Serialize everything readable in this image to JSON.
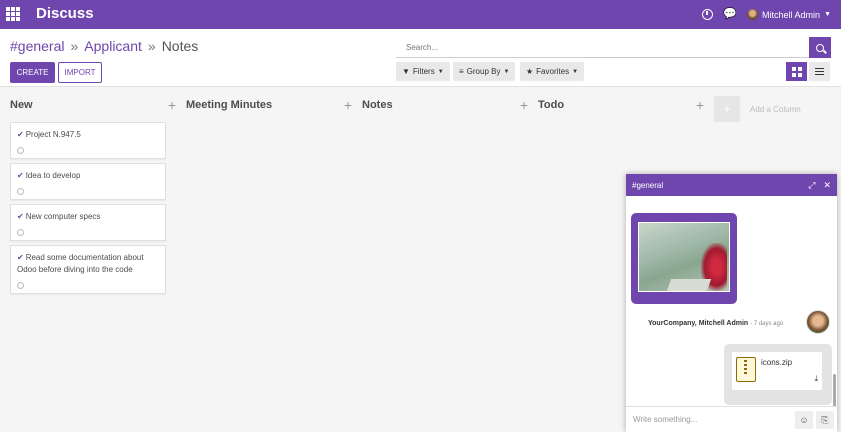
{
  "navbar": {
    "app_title": "Discuss",
    "user_name": "Mitchell Admin",
    "accent": "#6e46ad"
  },
  "breadcrumb": {
    "items": [
      "#general",
      "Applicant"
    ],
    "current": "Notes",
    "separator": "»"
  },
  "buttons": {
    "create": "CREATE",
    "import": "IMPORT"
  },
  "search": {
    "placeholder": "Search..."
  },
  "filters": {
    "filters_label": "Filters",
    "group_by_label": "Group By",
    "favorites_label": "Favorites"
  },
  "kanban": {
    "columns": [
      {
        "title": "New",
        "cards": [
          "Project N.947.5",
          "Idea to develop",
          "New computer specs",
          "Read some documentation about Odoo before diving into the code"
        ]
      },
      {
        "title": "Meeting Minutes",
        "cards": []
      },
      {
        "title": "Notes",
        "cards": []
      },
      {
        "title": "Todo",
        "cards": []
      }
    ],
    "add_column_label": "Add a Column"
  },
  "chat": {
    "title": "#general",
    "message_author": "YourCompany, Mitchell Admin",
    "message_time": "- 7 days ago",
    "attachment_name": "icons.zip",
    "composer_placeholder": "Write something..."
  }
}
